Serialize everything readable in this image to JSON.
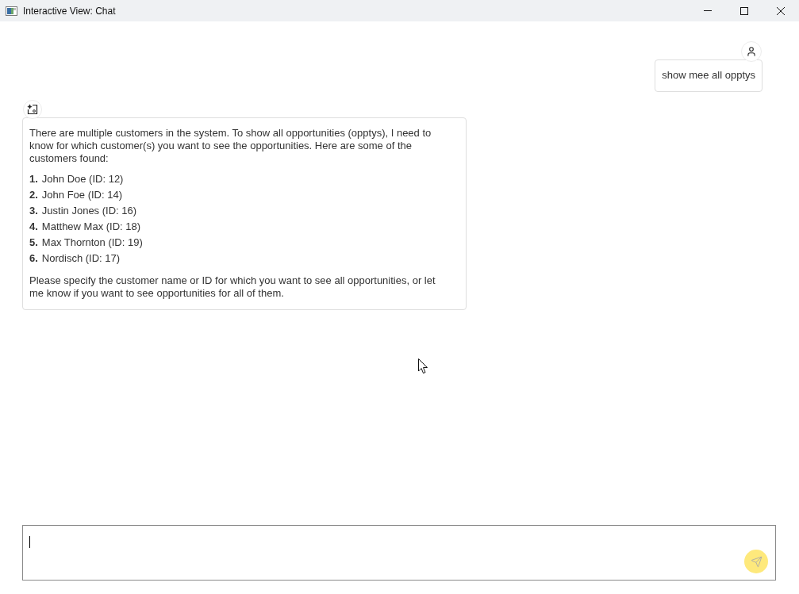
{
  "window": {
    "title": "Interactive View: Chat"
  },
  "messages": [
    {
      "kind": "user",
      "text": "show mee all opptys"
    },
    {
      "kind": "assistant",
      "intro": "There are multiple customers in the system. To show all opportunities (opptys), I need to know for which customer(s) you want to see the opportunities. Here are some of the customers found:",
      "list": [
        {
          "number": "1.",
          "text": "John Doe (ID: 12)"
        },
        {
          "number": "2.",
          "text": "John Foe (ID: 14)"
        },
        {
          "number": "3.",
          "text": "Justin Jones (ID: 16)"
        },
        {
          "number": "4.",
          "text": "Matthew Max (ID: 18)"
        },
        {
          "number": "5.",
          "text": "Max Thornton (ID: 19)"
        },
        {
          "number": "6.",
          "text": "Nordisch (ID: 17)"
        }
      ],
      "outro": "Please specify the customer name or ID for which you want to see all opportunities, or let me know if you want to see opportunities for all of them."
    }
  ],
  "composer": {
    "send_button": {
      "disabled": true
    }
  }
}
